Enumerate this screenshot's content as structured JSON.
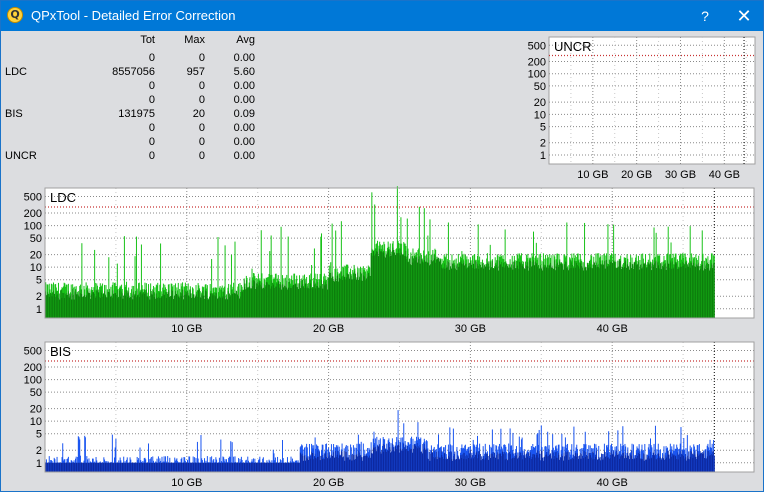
{
  "window": {
    "title": "QPxTool - Detailed Error Correction",
    "help_label": "?",
    "close_label": "✕",
    "icon": "qpxtool-app-icon",
    "icon_glyph": "Q"
  },
  "stats": {
    "headers": [
      "Tot",
      "Max",
      "Avg"
    ],
    "rows": [
      {
        "label": "",
        "tot": "0",
        "max": "0",
        "avg": "0.00"
      },
      {
        "label": "LDC",
        "tot": "8557056",
        "max": "957",
        "avg": "5.60"
      },
      {
        "label": "",
        "tot": "0",
        "max": "0",
        "avg": "0.00"
      },
      {
        "label": "",
        "tot": "0",
        "max": "0",
        "avg": "0.00"
      },
      {
        "label": "BIS",
        "tot": "131975",
        "max": "20",
        "avg": "0.09"
      },
      {
        "label": "",
        "tot": "0",
        "max": "0",
        "avg": "0.00"
      },
      {
        "label": "",
        "tot": "0",
        "max": "0",
        "avg": "0.00"
      },
      {
        "label": "UNCR",
        "tot": "0",
        "max": "0",
        "avg": "0.00"
      }
    ]
  },
  "colors": {
    "ldc_light": "#18c218",
    "ldc_dark": "#0b6e0b",
    "bis": "#1a55f0",
    "bis_dark": "#0a1e8c",
    "threshold": "#c83232",
    "grid": "#8a8a8a"
  },
  "chart_data": [
    {
      "id": "uncr",
      "type": "bar",
      "title": "UNCR",
      "y_scale": "log",
      "y_ticks": [
        1,
        2,
        5,
        10,
        20,
        50,
        100,
        200,
        500
      ],
      "x_ticks": [
        10,
        20,
        30,
        40
      ],
      "x_tick_labels": [
        "10 GB",
        "20 GB",
        "30 GB",
        "40 GB"
      ],
      "xlim": [
        0,
        47
      ],
      "ylim": [
        1,
        500
      ],
      "end_marker": 44.5,
      "threshold": 280,
      "series": [
        {
          "values": []
        }
      ]
    },
    {
      "id": "ldc",
      "type": "bar",
      "title": "LDC",
      "y_scale": "log",
      "y_ticks": [
        1,
        2,
        5,
        10,
        20,
        50,
        100,
        200,
        500
      ],
      "x_ticks": [
        10,
        20,
        30,
        40
      ],
      "x_tick_labels": [
        "10 GB",
        "20 GB",
        "30 GB",
        "40 GB"
      ],
      "xlim": [
        0,
        50
      ],
      "ylim": [
        1,
        957
      ],
      "end_marker": 47.2,
      "threshold": 280,
      "max_value": 957,
      "segments": [
        {
          "x0": 0.0,
          "x1": 14.0,
          "typ": 3,
          "peak": 60,
          "floor": 1
        },
        {
          "x0": 14.0,
          "x1": 20.0,
          "typ": 5,
          "peak": 100,
          "floor": 1
        },
        {
          "x0": 20.0,
          "x1": 23.0,
          "typ": 8,
          "peak": 150,
          "floor": 1
        },
        {
          "x0": 23.0,
          "x1": 25.5,
          "typ": 30,
          "peak": 957,
          "floor": 2
        },
        {
          "x0": 25.5,
          "x1": 28.0,
          "typ": 20,
          "peak": 300,
          "floor": 1
        },
        {
          "x0": 28.0,
          "x1": 47.2,
          "typ": 15,
          "peak": 120,
          "floor": 2
        }
      ]
    },
    {
      "id": "bis",
      "type": "bar",
      "title": "BIS",
      "y_scale": "log",
      "y_ticks": [
        1,
        2,
        5,
        10,
        20,
        50,
        100,
        200,
        500
      ],
      "x_ticks": [
        10,
        20,
        30,
        40
      ],
      "x_tick_labels": [
        "10 GB",
        "20 GB",
        "30 GB",
        "40 GB"
      ],
      "xlim": [
        0,
        50
      ],
      "ylim": [
        1,
        500
      ],
      "end_marker": 47.2,
      "threshold": 280,
      "max_value": 20,
      "segments": [
        {
          "x0": 0.0,
          "x1": 18.0,
          "typ": 1,
          "peak": 5,
          "floor": 1
        },
        {
          "x0": 18.0,
          "x1": 23.0,
          "typ": 2,
          "peak": 5,
          "floor": 1
        },
        {
          "x0": 23.0,
          "x1": 27.0,
          "typ": 3,
          "peak": 20,
          "floor": 1
        },
        {
          "x0": 27.0,
          "x1": 47.2,
          "typ": 2,
          "peak": 8,
          "floor": 1
        }
      ]
    }
  ]
}
